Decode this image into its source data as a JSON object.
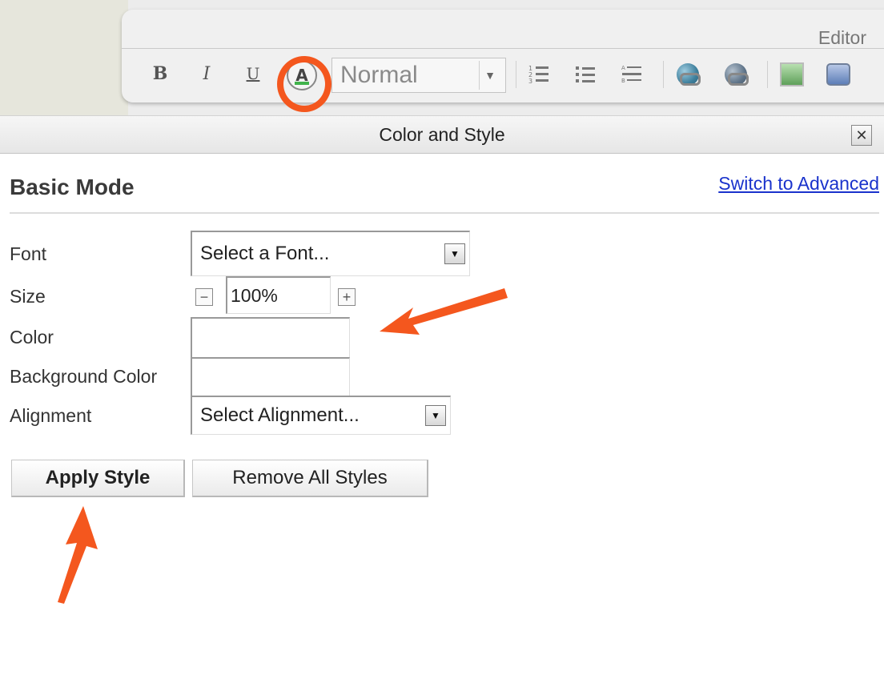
{
  "editor": {
    "title": "Editor",
    "toolbar": {
      "bold": "B",
      "italic": "I",
      "underline": "U",
      "text_color_icon": "A",
      "format_value": "Normal",
      "icons": [
        "numbered-list-icon",
        "bullet-list-icon",
        "definition-list-icon",
        "insert-link-icon",
        "remove-link-icon",
        "insert-image-icon",
        "insert-media-icon"
      ]
    }
  },
  "dialog": {
    "title": "Color and Style",
    "close_symbol": "✕",
    "mode_title": "Basic Mode",
    "switch_link": "Switch to Advanced",
    "labels": {
      "font": "Font",
      "size": "Size",
      "color": "Color",
      "background_color": "Background Color",
      "alignment": "Alignment"
    },
    "font_select": "Select a Font...",
    "size_value": "100%",
    "size_minus": "−",
    "size_plus": "+",
    "color_value": "",
    "background_color_value": "",
    "alignment_select": "Select Alignment...",
    "apply_button": "Apply Style",
    "remove_button": "Remove All Styles"
  },
  "colors": {
    "annotation": "#f4571e",
    "link": "#1a33cc"
  }
}
